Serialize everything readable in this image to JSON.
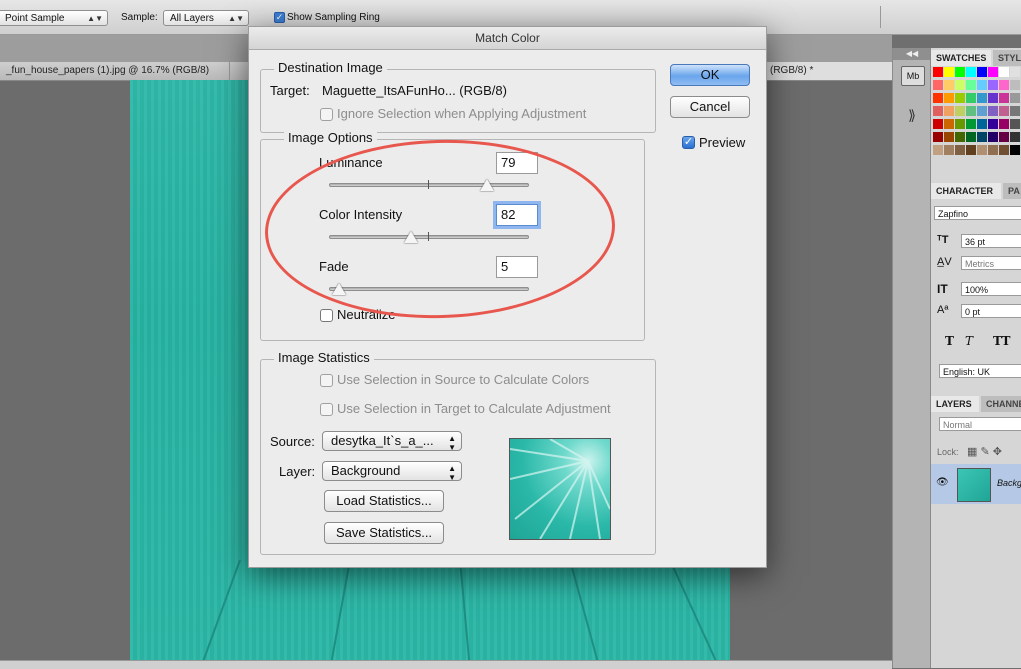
{
  "options_bar": {
    "sample_size_value": "Point Sample",
    "sample_label": "Sample:",
    "sample_value": "All Layers",
    "show_ring_label": "Show Sampling Ring",
    "show_ring_checked": true
  },
  "doc_tabs": [
    {
      "label": "_fun_house_papers (1).jpg @ 16.7% (RGB/8)",
      "active": false
    },
    {
      "label": "(RGB/8) *",
      "active": true
    }
  ],
  "dialog": {
    "title": "Match Color",
    "destination": {
      "group_label": "Destination Image",
      "target_label": "Target:",
      "target_value": "Maguette_ItsAFunHo... (RGB/8)",
      "ignore_selection_label": "Ignore Selection when Applying Adjustment"
    },
    "image_options": {
      "group_label": "Image Options",
      "luminance_label": "Luminance",
      "luminance_value": "79",
      "luminance_level": 0.79,
      "color_intensity_label": "Color Intensity",
      "color_intensity_value": "82",
      "color_intensity_level": 0.41,
      "fade_label": "Fade",
      "fade_value": "5",
      "fade_level": 0.05,
      "neutralize_label": "Neutralize"
    },
    "image_statistics": {
      "group_label": "Image Statistics",
      "use_source_label": "Use Selection in Source to Calculate Colors",
      "use_target_label": "Use Selection in Target to Calculate Adjustment",
      "source_label": "Source:",
      "source_value": "desytka_It`s_a_...",
      "layer_label": "Layer:",
      "layer_value": "Background",
      "load_label": "Load Statistics...",
      "save_label": "Save Statistics..."
    },
    "buttons": {
      "ok_label": "OK",
      "cancel_label": "Cancel",
      "preview_label": "Preview",
      "preview_checked": true
    }
  },
  "panels": {
    "swatches_tab": "SWATCHES",
    "styles_tab": "STYL",
    "character_tab": "CHARACTER",
    "paragraph_tab": "PA",
    "font_family": "Zapfino",
    "font_size": "36 pt",
    "kerning": "Metrics",
    "vertical_scale": "100%",
    "baseline_shift": "0 pt",
    "language": "English: UK",
    "layers_tab": "LAYERS",
    "channels_tab": "CHANNE",
    "blend_mode": "Normal",
    "lock_label": "Lock:",
    "layer_name": "Backg",
    "mb_icon_label": "Mb"
  },
  "colors": {
    "accent_oval": "#e8574d",
    "canvas_teal": "#2cb7a6",
    "ok_button": "#6aa5ec"
  }
}
